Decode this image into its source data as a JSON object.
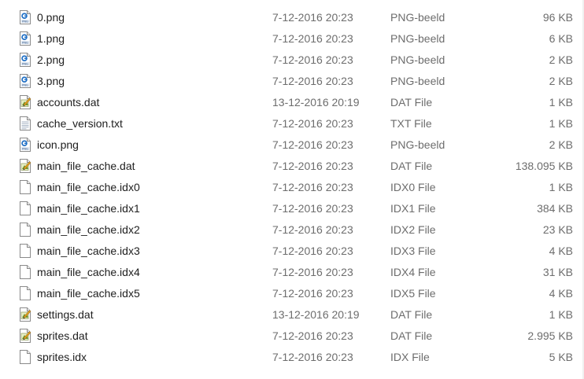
{
  "files": [
    {
      "name": "0.png",
      "date": "7-12-2016 20:23",
      "type": "PNG-beeld",
      "size": "96 KB",
      "icon": "png-image-icon"
    },
    {
      "name": "1.png",
      "date": "7-12-2016 20:23",
      "type": "PNG-beeld",
      "size": "6 KB",
      "icon": "png-image-icon"
    },
    {
      "name": "2.png",
      "date": "7-12-2016 20:23",
      "type": "PNG-beeld",
      "size": "2 KB",
      "icon": "png-image-icon"
    },
    {
      "name": "3.png",
      "date": "7-12-2016 20:23",
      "type": "PNG-beeld",
      "size": "2 KB",
      "icon": "png-image-icon"
    },
    {
      "name": "accounts.dat",
      "date": "13-12-2016 20:19",
      "type": "DAT File",
      "size": "1 KB",
      "icon": "dat-file-icon"
    },
    {
      "name": "cache_version.txt",
      "date": "7-12-2016 20:23",
      "type": "TXT File",
      "size": "1 KB",
      "icon": "text-file-icon"
    },
    {
      "name": "icon.png",
      "date": "7-12-2016 20:23",
      "type": "PNG-beeld",
      "size": "2 KB",
      "icon": "png-image-icon"
    },
    {
      "name": "main_file_cache.dat",
      "date": "7-12-2016 20:23",
      "type": "DAT File",
      "size": "138.095 KB",
      "icon": "dat-file-icon"
    },
    {
      "name": "main_file_cache.idx0",
      "date": "7-12-2016 20:23",
      "type": "IDX0 File",
      "size": "1 KB",
      "icon": "blank-file-icon"
    },
    {
      "name": "main_file_cache.idx1",
      "date": "7-12-2016 20:23",
      "type": "IDX1 File",
      "size": "384 KB",
      "icon": "blank-file-icon"
    },
    {
      "name": "main_file_cache.idx2",
      "date": "7-12-2016 20:23",
      "type": "IDX2 File",
      "size": "23 KB",
      "icon": "blank-file-icon"
    },
    {
      "name": "main_file_cache.idx3",
      "date": "7-12-2016 20:23",
      "type": "IDX3 File",
      "size": "4 KB",
      "icon": "blank-file-icon"
    },
    {
      "name": "main_file_cache.idx4",
      "date": "7-12-2016 20:23",
      "type": "IDX4 File",
      "size": "31 KB",
      "icon": "blank-file-icon"
    },
    {
      "name": "main_file_cache.idx5",
      "date": "7-12-2016 20:23",
      "type": "IDX5 File",
      "size": "4 KB",
      "icon": "blank-file-icon"
    },
    {
      "name": "settings.dat",
      "date": "13-12-2016 20:19",
      "type": "DAT File",
      "size": "1 KB",
      "icon": "dat-file-icon"
    },
    {
      "name": "sprites.dat",
      "date": "7-12-2016 20:23",
      "type": "DAT File",
      "size": "2.995 KB",
      "icon": "dat-file-icon"
    },
    {
      "name": "sprites.idx",
      "date": "7-12-2016 20:23",
      "type": "IDX File",
      "size": "5 KB",
      "icon": "blank-file-icon"
    }
  ]
}
